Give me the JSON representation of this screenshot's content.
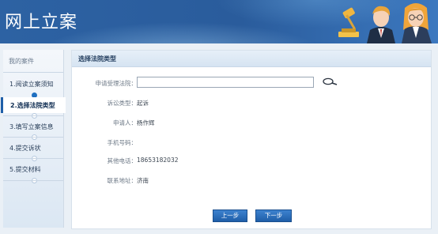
{
  "header": {
    "title": "网上立案"
  },
  "sidebar": {
    "heading": "我的案件",
    "steps": [
      {
        "label": "1.阅读立案须知"
      },
      {
        "label": "2.选择法院类型"
      },
      {
        "label": "3.填写立案信息"
      },
      {
        "label": "4.提交诉状"
      },
      {
        "label": "5.提交材料"
      }
    ],
    "active_step": 2
  },
  "main": {
    "panel_title": "选择法院类型",
    "court": {
      "label": "申请受理法院：",
      "value": "",
      "placeholder": ""
    },
    "fields": [
      {
        "label": "诉讼类型：",
        "value": "起诉"
      },
      {
        "label": "申请人：",
        "value": "杨作辉"
      },
      {
        "label": "手机号码：",
        "value": ""
      },
      {
        "label": "其他电话：",
        "value": "18653182032"
      },
      {
        "label": "联系地址：",
        "value": "济南"
      }
    ],
    "buttons": {
      "prev": "上一步",
      "next": "下一步"
    }
  },
  "colors": {
    "header_blue": "#2a5c9c",
    "accent": "#1f5fa8",
    "page_bg": "#eaf0f6"
  },
  "icons": [
    "search-icon",
    "judge-gavel-icon",
    "lawyer-figures-illustration"
  ]
}
